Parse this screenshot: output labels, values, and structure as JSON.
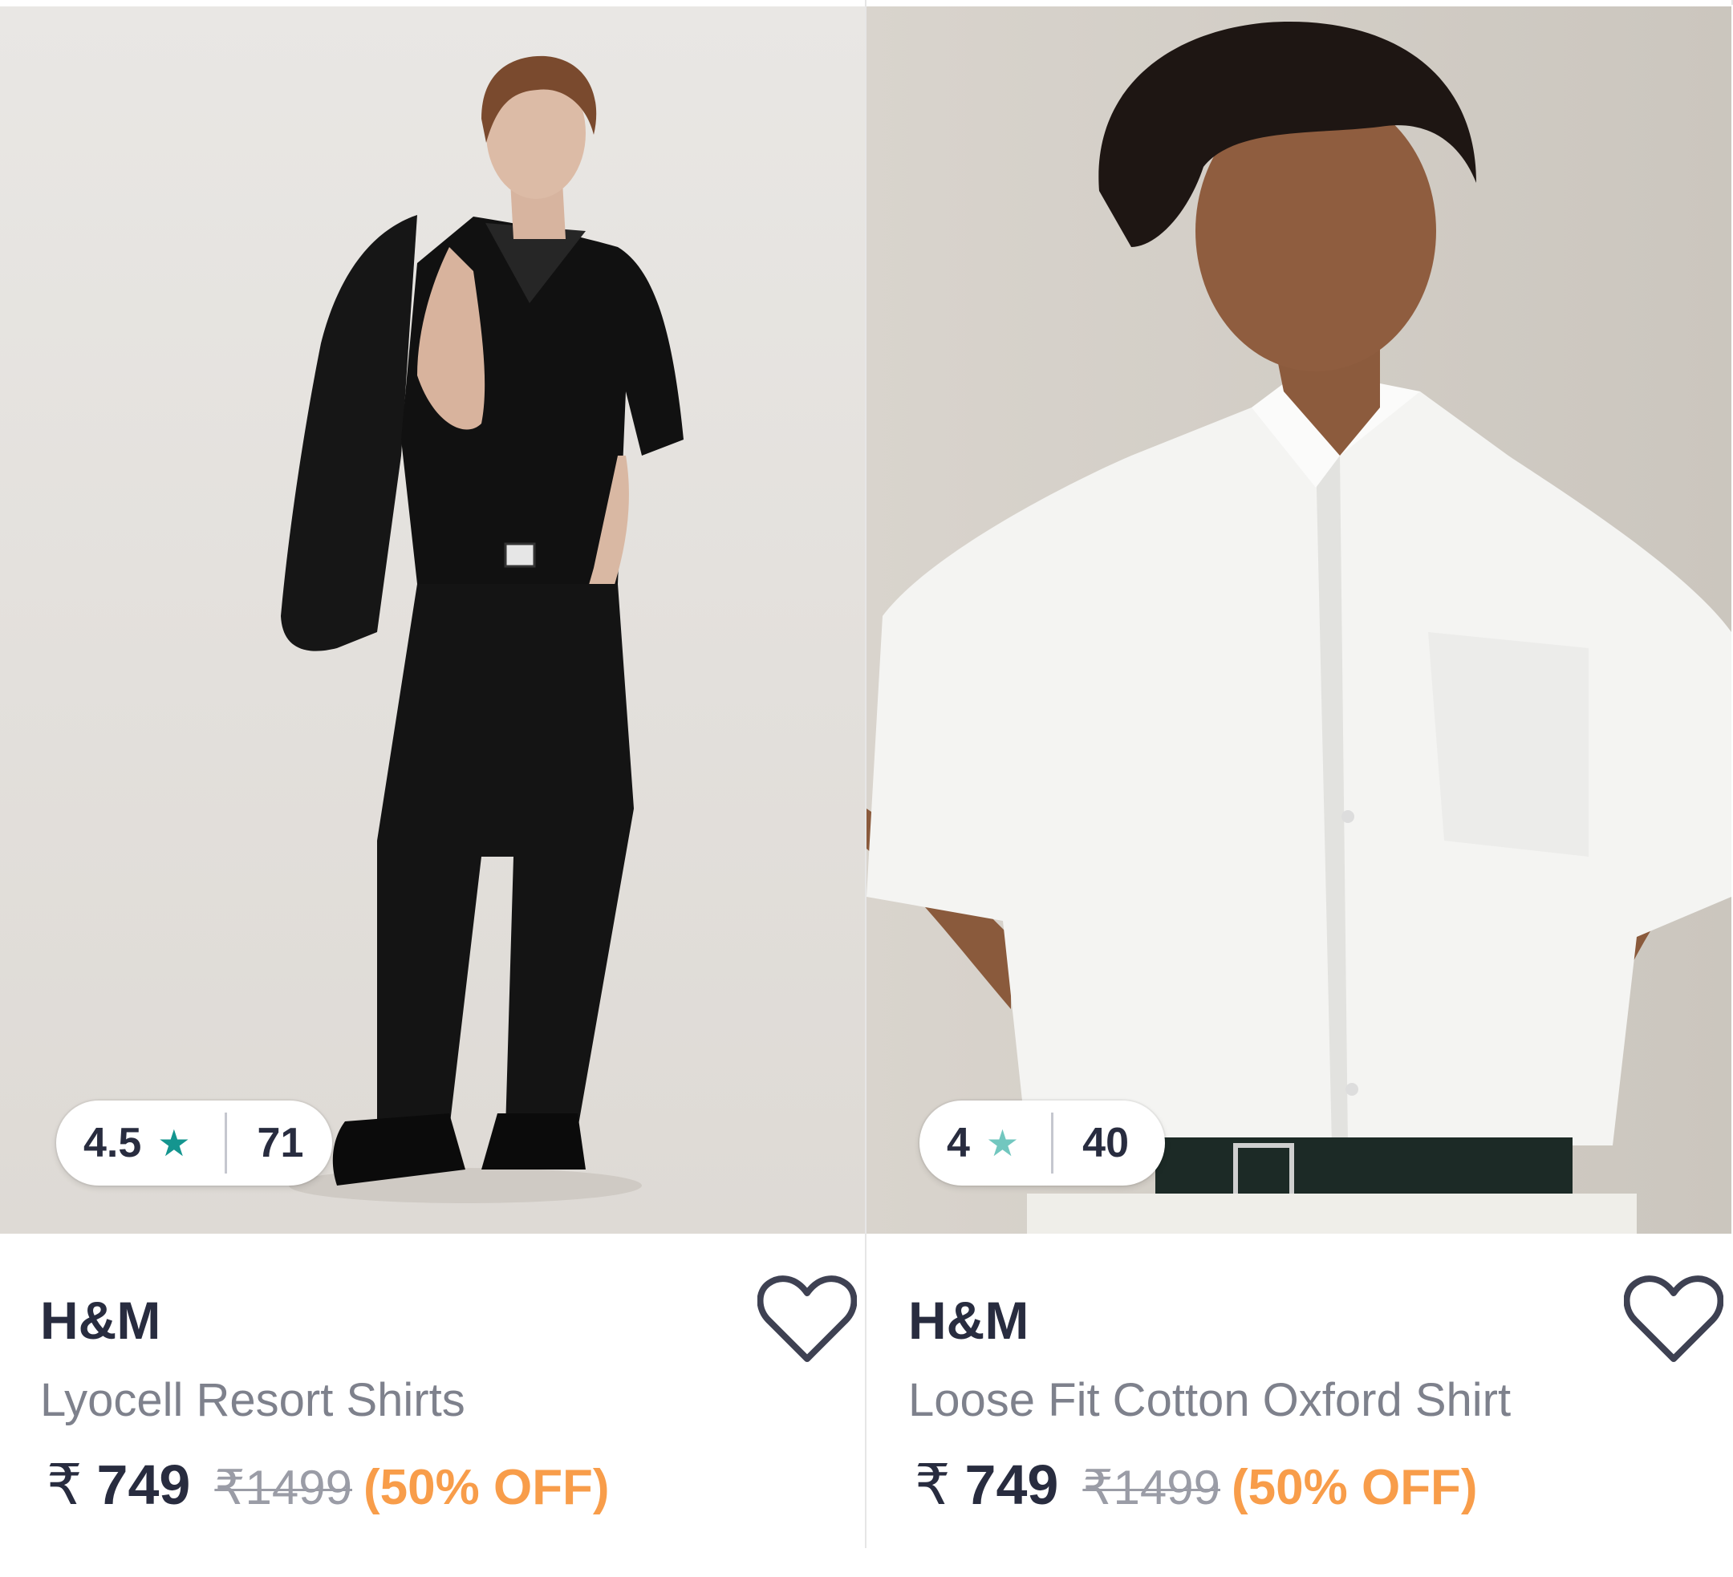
{
  "products": [
    {
      "rating": "4.5",
      "rating_count": "71",
      "star_glyph": "★",
      "star_color": "#14958f",
      "brand": "H&M",
      "name": "Lyocell Resort Shirts",
      "currency": "₹",
      "price": "749",
      "mrp": "₹1499",
      "discount": "(50% OFF)",
      "image_icon": "model-black-outfit-image",
      "wishlist_icon": "heart-outline-icon"
    },
    {
      "rating": "4",
      "rating_count": "40",
      "star_glyph": "★",
      "star_color": "#72c7bf",
      "brand": "H&M",
      "name": "Loose Fit Cotton Oxford Shirt",
      "currency": "₹",
      "price": "749",
      "mrp": "₹1499",
      "discount": "(50% OFF)",
      "image_icon": "model-white-shirt-image",
      "wishlist_icon": "heart-outline-icon"
    }
  ],
  "colors": {
    "text_primary": "#282c3f",
    "text_secondary": "#7e818c",
    "discount": "#f89d4a",
    "mrp": "#9a9ca6"
  }
}
